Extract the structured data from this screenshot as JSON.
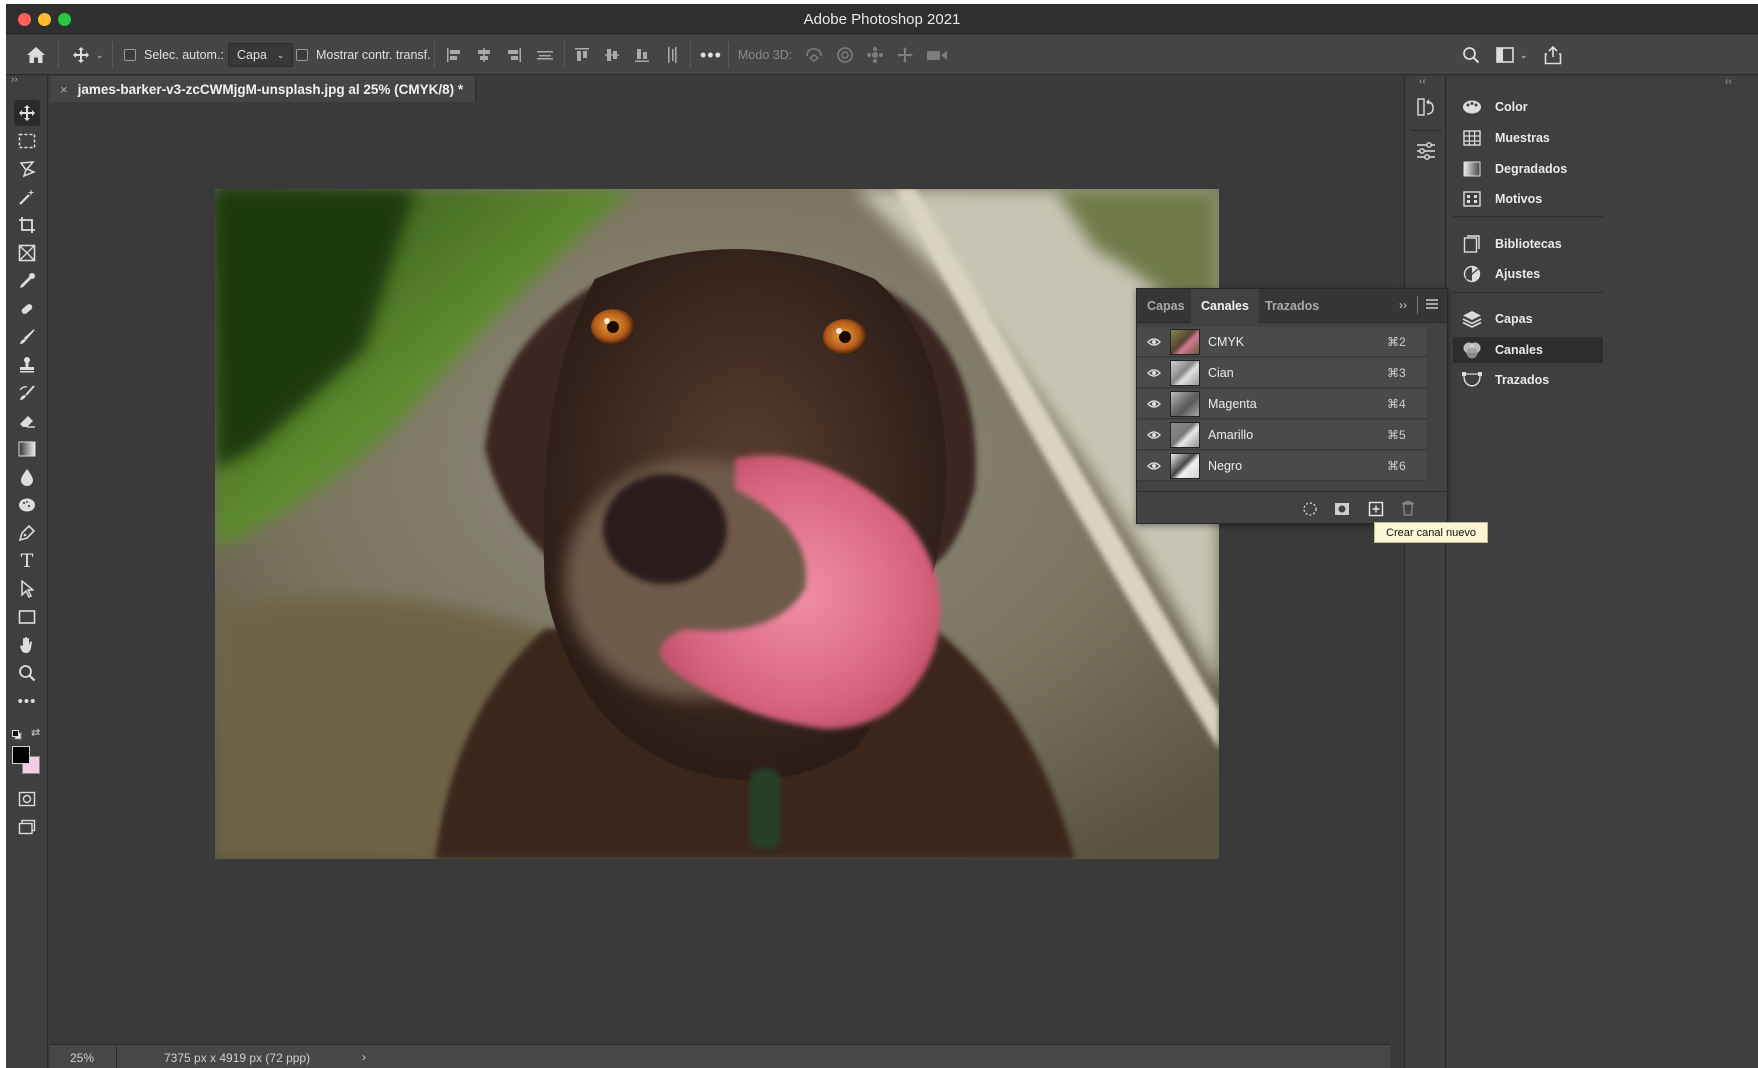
{
  "window": {
    "title": "Adobe Photoshop 2021"
  },
  "options_bar": {
    "auto_select_label": "Selec. autom.:",
    "auto_select_value": "Capa",
    "show_transform_label": "Mostrar contr. transf.",
    "mode_3d_label": "Modo 3D:"
  },
  "document": {
    "tab_title": "james-barker-v3-zcCWMjgM-unsplash.jpg al 25% (CMYK/8) *",
    "zoom": "25%",
    "dimensions": "7375 px x 4919 px (72 ppp)"
  },
  "right_panels": [
    {
      "label": "Color",
      "icon": "color-icon"
    },
    {
      "label": "Muestras",
      "icon": "swatches-icon"
    },
    {
      "label": "Degradados",
      "icon": "gradient-icon"
    },
    {
      "label": "Motivos",
      "icon": "patterns-icon"
    },
    {
      "label": "Bibliotecas",
      "icon": "libraries-icon"
    },
    {
      "label": "Ajustes",
      "icon": "adjustments-icon"
    },
    {
      "label": "Capas",
      "icon": "layers-icon"
    },
    {
      "label": "Canales",
      "icon": "channels-icon"
    },
    {
      "label": "Trazados",
      "icon": "paths-icon"
    }
  ],
  "channels_panel": {
    "tabs": [
      "Capas",
      "Canales",
      "Trazados"
    ],
    "active_tab": "Canales",
    "channels": [
      {
        "name": "CMYK",
        "shortcut": "⌘2"
      },
      {
        "name": "Cian",
        "shortcut": "⌘3"
      },
      {
        "name": "Magenta",
        "shortcut": "⌘4"
      },
      {
        "name": "Amarillo",
        "shortcut": "⌘5"
      },
      {
        "name": "Negro",
        "shortcut": "⌘6"
      }
    ],
    "tooltip": "Crear canal nuevo"
  },
  "colors": {
    "foreground": "#000000",
    "background": "#f2cde3"
  }
}
